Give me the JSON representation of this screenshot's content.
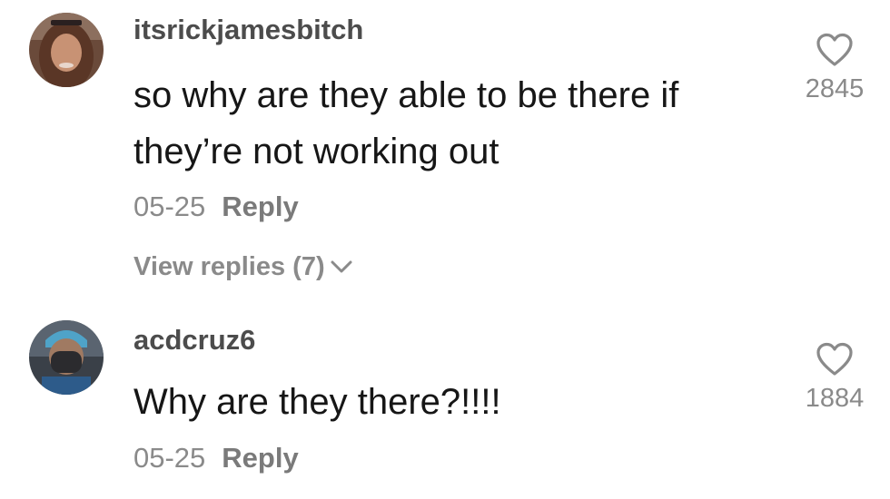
{
  "comments": [
    {
      "username": "itsrickjamesbitch",
      "text": "so why are they able to be there if they’re not working out",
      "date": "05-25",
      "reply_label": "Reply",
      "likes": "2845",
      "avatar_icon": "profile-photo"
    },
    {
      "username": "acdcruz6",
      "text": "Why are they there?!!!!",
      "date": "05-25",
      "reply_label": "Reply",
      "likes": "1884",
      "avatar_icon": "profile-photo"
    }
  ],
  "view_replies_label": "View replies (7)",
  "colors": {
    "text": "#161616",
    "username": "#4c4c4c",
    "muted": "#8a8a8a"
  }
}
